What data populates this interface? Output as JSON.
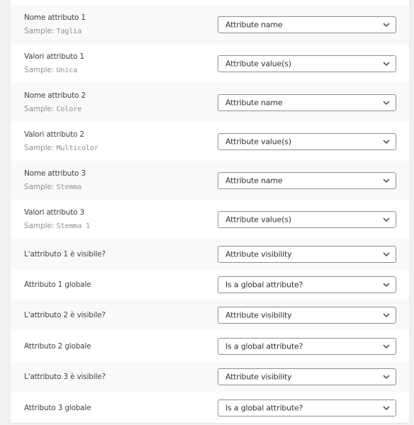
{
  "sample_prefix": "Sample:",
  "rows": [
    {
      "label": "Nome attributo 1",
      "sample": "Taglia",
      "select": "Attribute name"
    },
    {
      "label": "Valori attributo 1",
      "sample": "Unica",
      "select": "Attribute value(s)"
    },
    {
      "label": "Nome attributo 2",
      "sample": "Colore",
      "select": "Attribute name"
    },
    {
      "label": "Valori attributo 2",
      "sample": "Multicolor",
      "select": "Attribute value(s)"
    },
    {
      "label": "Nome attributo 3",
      "sample": "Stemma",
      "select": "Attribute name"
    },
    {
      "label": "Valori attributo 3",
      "sample": "Stemma 1",
      "select": "Attribute value(s)"
    },
    {
      "label": "L'attributo 1 è visibile?",
      "select": "Attribute visibility"
    },
    {
      "label": "Attributo 1 globale",
      "select": "Is a global attribute?"
    },
    {
      "label": "L'attributo 2 è visibile?",
      "select": "Attribute visibility"
    },
    {
      "label": "Attributo 2 globale",
      "select": "Is a global attribute?"
    },
    {
      "label": "L'attributo 3 è visibile?",
      "select": "Attribute visibility"
    },
    {
      "label": "Attributo 3 globale",
      "select": "Is a global attribute?"
    }
  ],
  "icons": {
    "select_arrow": "chevron-down-icon"
  },
  "colors": {
    "page_bg": "#f0f0f1",
    "row_alt_bg": "#f9f9f9",
    "select_border": "#8c8f94",
    "sample_text": "#8c8f94"
  }
}
